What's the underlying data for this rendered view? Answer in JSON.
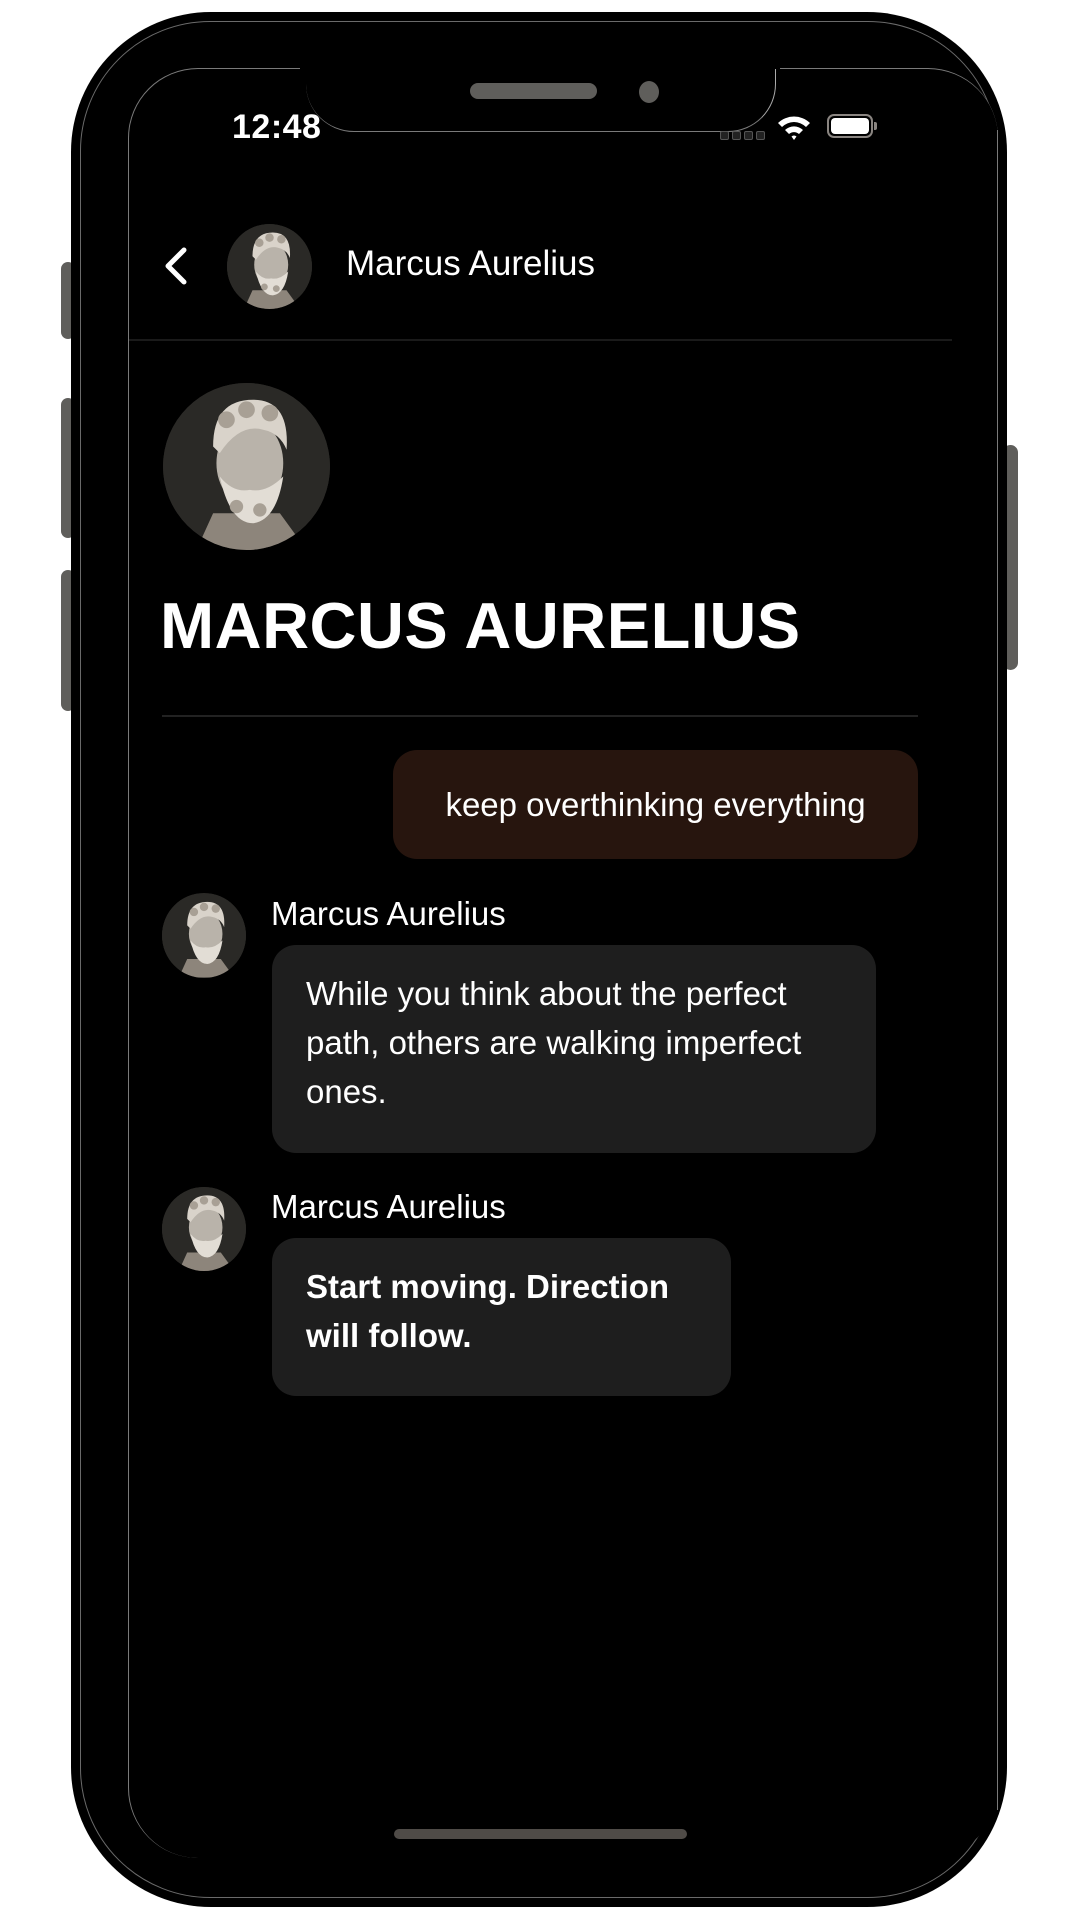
{
  "status_bar": {
    "time": "12:48",
    "wifi_icon": "wifi-icon",
    "battery_icon": "battery-full-icon"
  },
  "header": {
    "back_icon": "chevron-left-icon",
    "contact_name": "Marcus Aurelius",
    "avatar": "marcus-aurelius-bust-avatar"
  },
  "profile": {
    "title": "MARCUS AURELIUS",
    "avatar": "marcus-aurelius-bust-avatar"
  },
  "messages": [
    {
      "sender": "user",
      "text": "keep overthinking everything",
      "bold": false
    },
    {
      "sender": "Marcus Aurelius",
      "text": "While you think about the perfect path, others are walking imperfect ones.",
      "bold": false
    },
    {
      "sender": "Marcus Aurelius",
      "text": "Start moving. Direction will follow.",
      "bold": true
    }
  ],
  "colors": {
    "background": "#000000",
    "user_bubble": "#27150e",
    "bot_bubble": "#1e1e1e",
    "text": "#ffffff"
  }
}
